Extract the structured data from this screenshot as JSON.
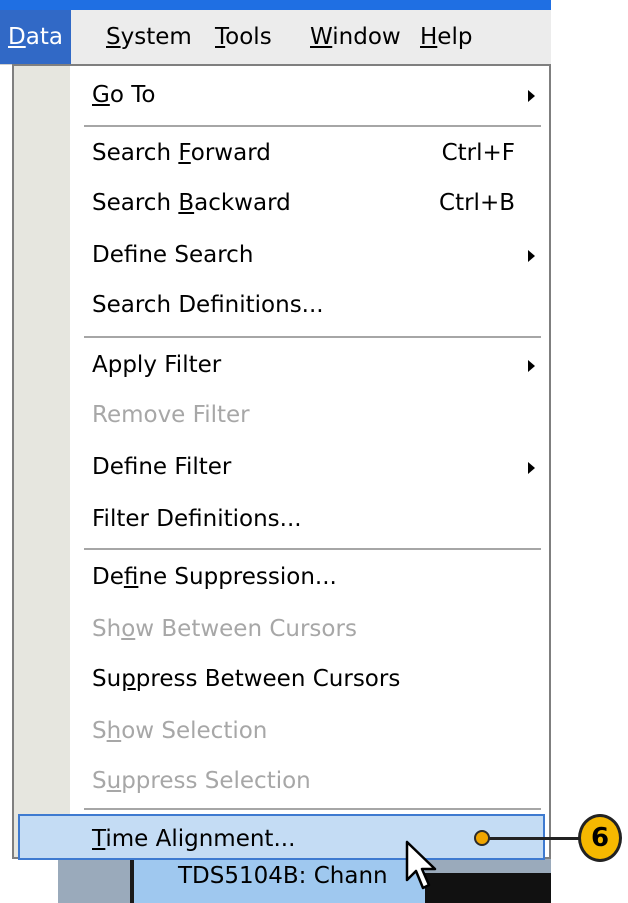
{
  "menubar": {
    "items": [
      {
        "pre": "",
        "ul": "D",
        "post": "ata"
      },
      {
        "pre": "",
        "ul": "S",
        "post": "ystem"
      },
      {
        "pre": "",
        "ul": "T",
        "post": "ools"
      },
      {
        "pre": "",
        "ul": "W",
        "post": "indow"
      },
      {
        "pre": "",
        "ul": "H",
        "post": "elp"
      }
    ]
  },
  "menu": {
    "items": [
      {
        "pre": "",
        "ul": "G",
        "post": "o To",
        "shortcut": "",
        "submenu": true,
        "enabled": true
      },
      {
        "pre": "Search ",
        "ul": "F",
        "post": "orward",
        "shortcut": "Ctrl+F",
        "submenu": false,
        "enabled": true
      },
      {
        "pre": "Search ",
        "ul": "B",
        "post": "ackward",
        "shortcut": "Ctrl+B",
        "submenu": false,
        "enabled": true
      },
      {
        "pre": "Define Search",
        "ul": "",
        "post": "",
        "shortcut": "",
        "submenu": true,
        "enabled": true
      },
      {
        "pre": "Search Definitions...",
        "ul": "",
        "post": "",
        "shortcut": "",
        "submenu": false,
        "enabled": true
      },
      {
        "pre": "Apply Filter",
        "ul": "",
        "post": "",
        "shortcut": "",
        "submenu": true,
        "enabled": true
      },
      {
        "pre": "Remove Filter",
        "ul": "",
        "post": "",
        "shortcut": "",
        "submenu": false,
        "enabled": false
      },
      {
        "pre": "Define Filter",
        "ul": "",
        "post": "",
        "shortcut": "",
        "submenu": true,
        "enabled": true
      },
      {
        "pre": "Filter Definitions...",
        "ul": "",
        "post": "",
        "shortcut": "",
        "submenu": false,
        "enabled": true
      },
      {
        "pre": "De",
        "ul": "f",
        "post": "ine Suppression...",
        "shortcut": "",
        "submenu": false,
        "enabled": true
      },
      {
        "pre": "Sh",
        "ul": "o",
        "post": "w Between Cursors",
        "shortcut": "",
        "submenu": false,
        "enabled": false
      },
      {
        "pre": "Su",
        "ul": "p",
        "post": "press Between Cursors",
        "shortcut": "",
        "submenu": false,
        "enabled": true
      },
      {
        "pre": "S",
        "ul": "h",
        "post": "ow Selection",
        "shortcut": "",
        "submenu": false,
        "enabled": false
      },
      {
        "pre": "S",
        "ul": "u",
        "post": "ppress Selection",
        "shortcut": "",
        "submenu": false,
        "enabled": false
      },
      {
        "pre": "",
        "ul": "T",
        "post": "ime Alignment...",
        "shortcut": "",
        "submenu": false,
        "enabled": true,
        "highlighted": true
      }
    ]
  },
  "background": {
    "field_text": "TDS5104B: Chann"
  },
  "callout": {
    "number": "6"
  },
  "colors": {
    "menu_highlight": "#3169c6",
    "hover_fill": "#c4dcf4",
    "callout": "#f6b800"
  }
}
